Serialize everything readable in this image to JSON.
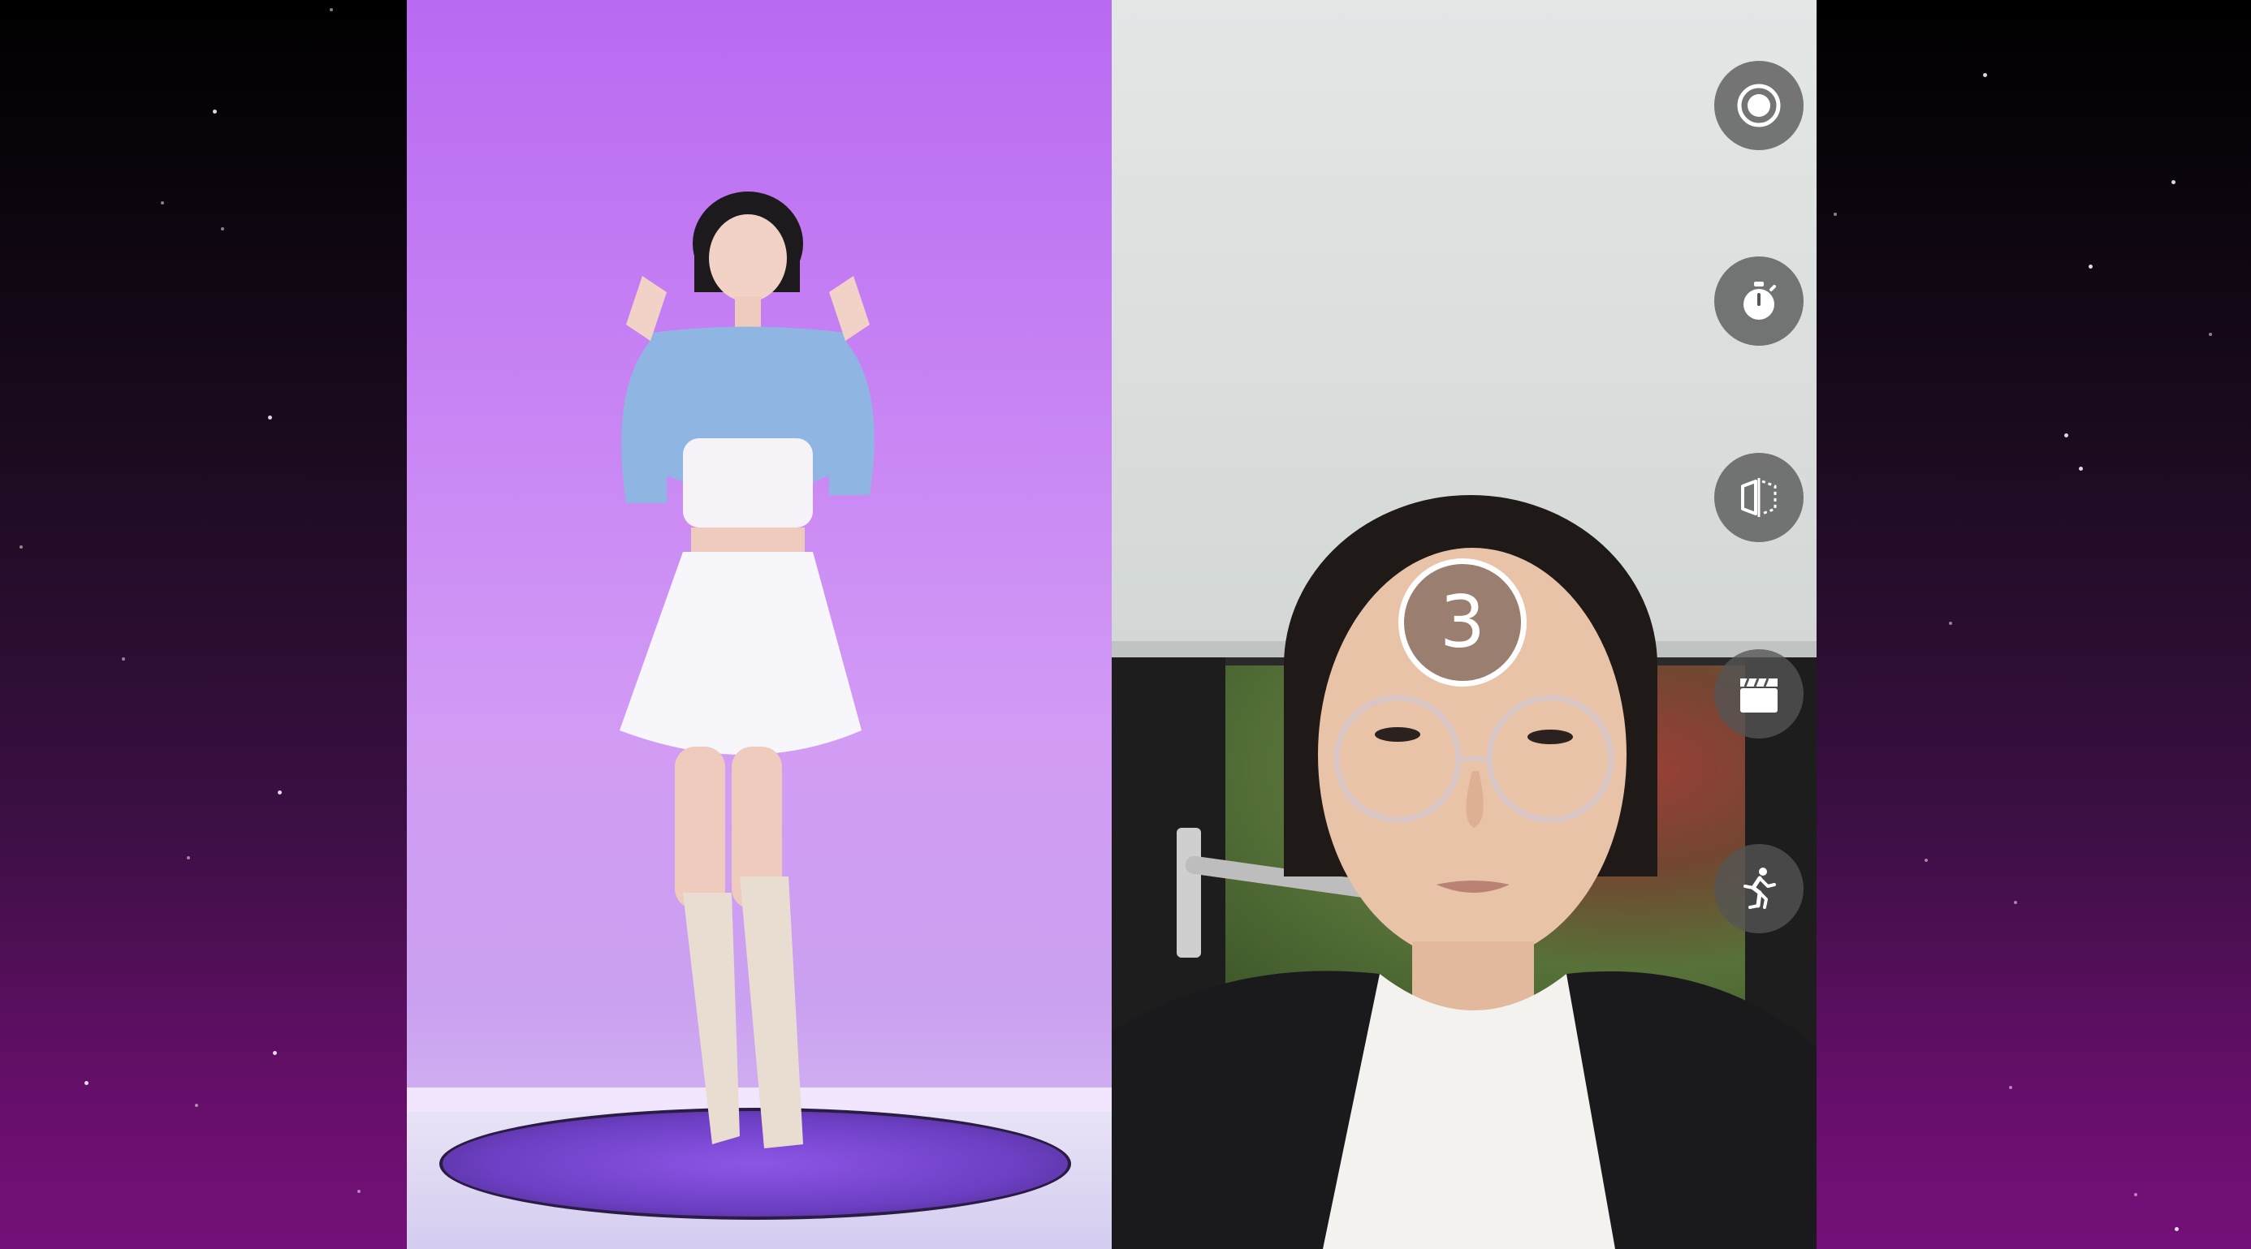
{
  "countdown": {
    "value": "3"
  },
  "controls": [
    {
      "id": "record",
      "icon": "record-icon"
    },
    {
      "id": "timer",
      "icon": "stopwatch-icon"
    },
    {
      "id": "mirror",
      "icon": "mirror-flip-icon"
    },
    {
      "id": "clip",
      "icon": "clapperboard-icon"
    },
    {
      "id": "motion",
      "icon": "running-person-icon"
    }
  ],
  "colors": {
    "background_top": "#000000",
    "background_bottom": "#74107a",
    "reference_backdrop": "#c986f4",
    "platform": "#6d3fc4",
    "control_button": "#555555",
    "countdown_ring": "#ffffff"
  }
}
